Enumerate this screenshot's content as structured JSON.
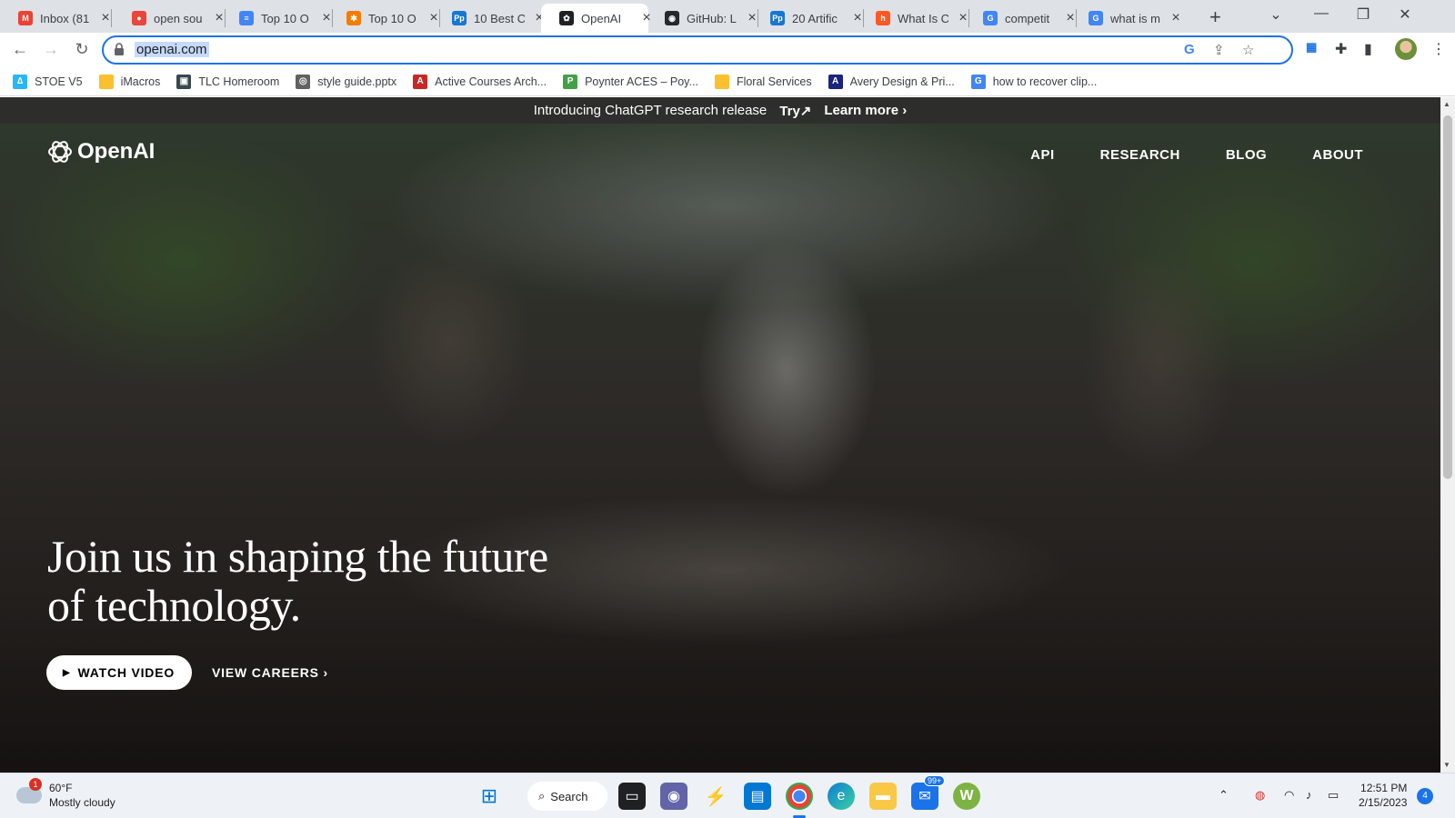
{
  "browser": {
    "tabs": [
      {
        "title": "Inbox (81",
        "favicon_color": "#ea4335",
        "favicon_glyph": "M",
        "active": false
      },
      {
        "title": "open sou",
        "favicon_color": "#e8453c",
        "favicon_glyph": "●",
        "active": false
      },
      {
        "title": "Top 10 O",
        "favicon_color": "#4285f4",
        "favicon_glyph": "≡",
        "active": false
      },
      {
        "title": "Top 10 O",
        "favicon_color": "#f57c00",
        "favicon_glyph": "✱",
        "active": false
      },
      {
        "title": "10 Best C",
        "favicon_color": "#1976d2",
        "favicon_glyph": "Pp",
        "active": false
      },
      {
        "title": "OpenAI",
        "favicon_color": "#202124",
        "favicon_glyph": "✿",
        "active": true
      },
      {
        "title": "GitHub: L",
        "favicon_color": "#24292f",
        "favicon_glyph": "◉",
        "active": false
      },
      {
        "title": "20 Artific",
        "favicon_color": "#1976d2",
        "favicon_glyph": "Pp",
        "active": false
      },
      {
        "title": "What Is C",
        "favicon_color": "#ff5722",
        "favicon_glyph": "h",
        "active": false
      },
      {
        "title": "competit",
        "favicon_color": "#4285f4",
        "favicon_glyph": "G",
        "active": false
      },
      {
        "title": "what is m",
        "favicon_color": "#4285f4",
        "favicon_glyph": "G",
        "active": false
      }
    ],
    "url": "openai.com",
    "bookmarks": [
      {
        "label": "STOE V5",
        "icon_color": "#29b6f6",
        "glyph": "∆"
      },
      {
        "label": "iMacros",
        "icon_color": "#fbc02d",
        "glyph": ""
      },
      {
        "label": "TLC Homeroom",
        "icon_color": "#37474f",
        "glyph": "▣"
      },
      {
        "label": "style guide.pptx",
        "icon_color": "#616161",
        "glyph": "◎"
      },
      {
        "label": "Active Courses Arch...",
        "icon_color": "#c62828",
        "glyph": "A"
      },
      {
        "label": "Poynter ACES – Poy...",
        "icon_color": "#43a047",
        "glyph": "P"
      },
      {
        "label": "Floral Services",
        "icon_color": "#fbc02d",
        "glyph": ""
      },
      {
        "label": "Avery Design & Pri...",
        "icon_color": "#1a237e",
        "glyph": "A"
      },
      {
        "label": "how to recover clip...",
        "icon_color": "#4285f4",
        "glyph": "G"
      }
    ]
  },
  "site": {
    "announcement": {
      "text": "Introducing ChatGPT research release",
      "try": "Try↗",
      "learn_more": "Learn more ›"
    },
    "logo_text": "OpenAI",
    "nav": [
      "API",
      "RESEARCH",
      "BLOG",
      "ABOUT"
    ],
    "hero_line1": "Join us in shaping the future",
    "hero_line2": "of technology.",
    "watch_video": "WATCH VIDEO",
    "view_careers": "VIEW CAREERS ›"
  },
  "taskbar": {
    "weather_badge": "1",
    "temperature": "60°F",
    "condition": "Mostly cloudy",
    "search_label": "Search",
    "mail_badge": "99+",
    "time": "12:51 PM",
    "date": "2/15/2023",
    "notifications": "4"
  }
}
